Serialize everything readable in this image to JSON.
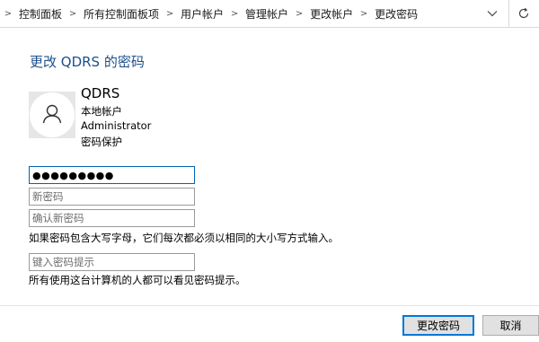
{
  "address_bar": {
    "breadcrumbs": [
      "控制面板",
      "所有控制面板项",
      "用户帐户",
      "管理帐户",
      "更改帐户",
      "更改密码"
    ],
    "dropdown_icon": "chevron-down-icon",
    "refresh_icon": "refresh-icon"
  },
  "page": {
    "title": "更改 QDRS 的密码"
  },
  "account": {
    "avatar_icon": "user-icon",
    "name": "QDRS",
    "type": "本地帐户",
    "group": "Administrator",
    "protection": "密码保护"
  },
  "form": {
    "current_password_value": "●●●●●●●●●",
    "new_password_placeholder": "新密码",
    "confirm_password_placeholder": "确认新密码",
    "case_note": "如果密码包含大写字母，它们每次都必须以相同的大小写方式输入。",
    "hint_placeholder": "键入密码提示",
    "hint_note": "所有使用这台计算机的人都可以看见密码提示。"
  },
  "buttons": {
    "change_password": "更改密码",
    "cancel": "取消"
  },
  "colors": {
    "title": "#1e4f8c",
    "focus_border": "#0078d7",
    "avatar_bg": "#e6e6e6"
  }
}
